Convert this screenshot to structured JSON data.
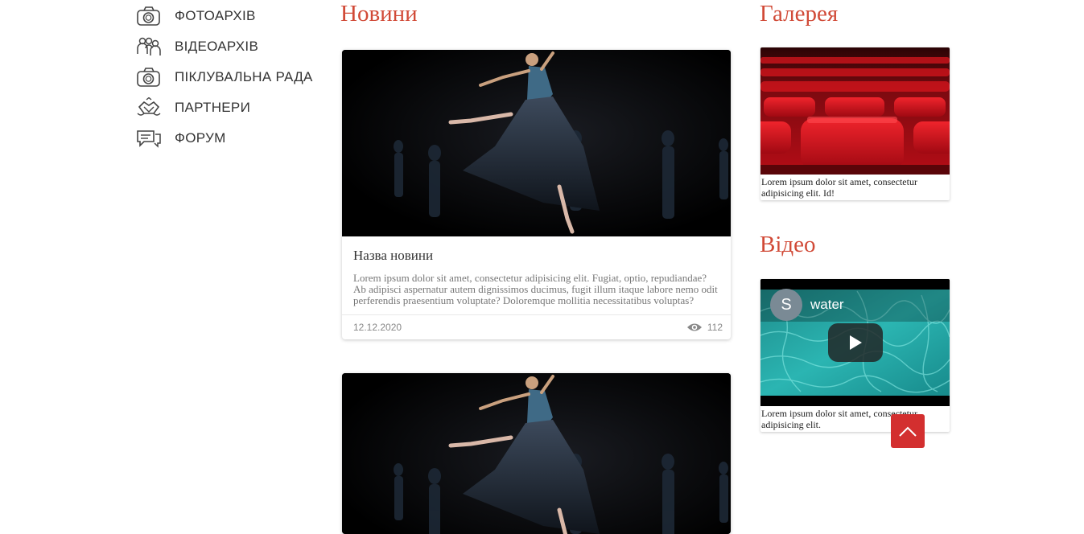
{
  "sidebar": {
    "items": [
      {
        "label": "ФОТОАРХІВ",
        "icon": "camera-icon"
      },
      {
        "label": "ВІДЕОАРХІВ",
        "icon": "people-icon"
      },
      {
        "label": "ПІКЛУВАЛЬНА РАДА",
        "icon": "camera-icon"
      },
      {
        "label": "ПАРТНЕРИ",
        "icon": "handshake-icon"
      },
      {
        "label": "ФОРУМ",
        "icon": "chat-icon"
      }
    ]
  },
  "news": {
    "title": "Новини",
    "items": [
      {
        "title": "Назва новини",
        "text": "Lorem ipsum dolor sit amet, consectetur adipisicing elit. Fugiat, optio, repudiandae? Ab adipisci aspernatur autem dignissimos ducimus, fugit illum itaque labore nemo odit perferendis praesentium voluptate? Doloremque mollitia necessitatibus voluptas?",
        "date": "12.12.2020",
        "views": "112"
      }
    ]
  },
  "gallery": {
    "title": "Галерея",
    "caption": "Lorem ipsum dolor sit amet, consectetur adipisicing elit. Id!"
  },
  "video": {
    "title": "Відео",
    "avatar_letter": "S",
    "video_title": "water",
    "caption": "Lorem ipsum dolor sit amet, consectetur adipisicing elit."
  },
  "colors": {
    "accent": "#d14a37",
    "scroll_button": "#d32f2f",
    "theater_red": "#c8101a",
    "water": "#2ab3b0"
  }
}
